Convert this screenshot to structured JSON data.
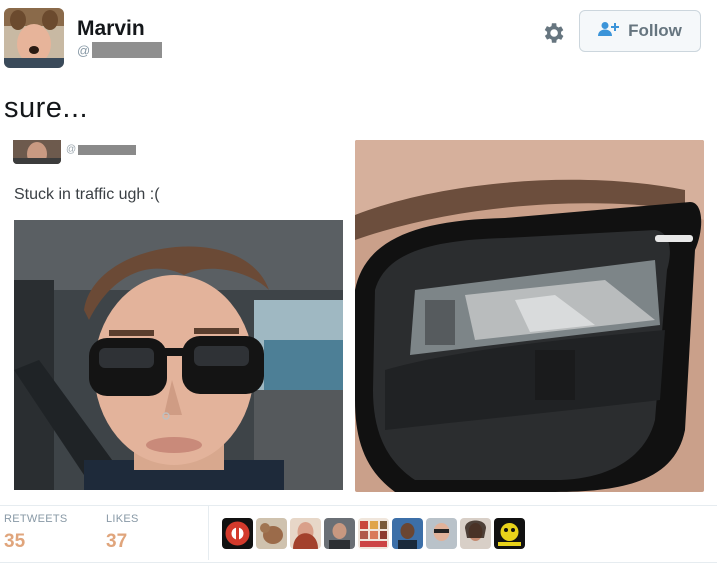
{
  "user": {
    "name": "Marvin",
    "handle_prefix": "@"
  },
  "actions": {
    "follow_label": "Follow"
  },
  "tweet": {
    "text": "sure..."
  },
  "quoted": {
    "handle_prefix": "@",
    "text": "Stuck in traffic ugh :("
  },
  "stats": {
    "retweets_label": "RETWEETS",
    "retweets_count": "35",
    "likes_label": "LIKES",
    "likes_count": "37"
  },
  "colors": {
    "follow_icon": "#3b94d9",
    "stat_number": "#e0a57c",
    "redaction": "#8f8f8f"
  },
  "icons": [
    "gear-icon",
    "add-user-icon"
  ]
}
